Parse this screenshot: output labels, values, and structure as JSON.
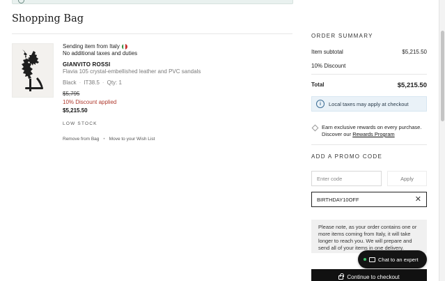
{
  "page": {
    "title": "Shopping Bag"
  },
  "item": {
    "shipping_origin": "Sending item from Italy",
    "tax_note": "No additional taxes and duties",
    "brand": "GIANVITO ROSSI",
    "name": "Flavia 105 crystal-embellished leather and PVC sandals",
    "color": "Black",
    "size": "IT38.5",
    "qty": "Qty: 1",
    "original_price": "$5,795",
    "discount_label": "10% Discount applied",
    "final_price": "$5,215.50",
    "stock_status": "LOW STOCK",
    "remove_label": "Remove from Bag",
    "wishlist_label": "Move to your Wish List"
  },
  "summary": {
    "heading": "ORDER SUMMARY",
    "subtotal_label": "Item subtotal",
    "subtotal_value": "$5,215.50",
    "discount_label": "10% Discount",
    "total_label": "Total",
    "total_value": "$5,215.50",
    "tax_notice": "Local taxes may apply at checkout",
    "rewards_text": "Earn exclusive rewards on every purchase. Discover our",
    "rewards_link": "Rewards Program",
    "promo_heading": "ADD A PROMO CODE",
    "promo_placeholder": "Enter code",
    "apply_label": "Apply",
    "applied_code": "BIRTHDAY10OFF",
    "shipping_notice": "Please note, as your order contains one or more items coming from Italy, it will take longer to reach you. We will prepare and send all of your items in one delivery.",
    "checkout_label": "Continue to checkout"
  },
  "chat": {
    "label": "Chat to an expert"
  },
  "colors": {
    "discount_red": "#b03a2e",
    "info_bg": "#eaf2f8",
    "button_dark": "#111111",
    "status_green": "#3ec46d"
  }
}
